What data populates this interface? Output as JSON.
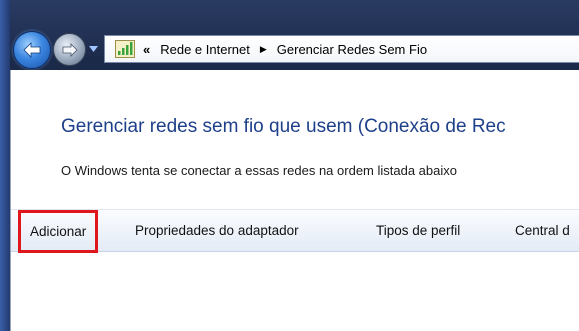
{
  "window": {
    "breadcrumb": {
      "overflow_label": "«",
      "items": [
        "Rede e Internet",
        "Gerenciar Redes Sem Fio"
      ],
      "separator": "▶"
    }
  },
  "icons": {
    "back": "back-arrow-icon",
    "forward": "forward-arrow-icon",
    "history": "chevron-down-icon",
    "network": "network-signal-icon"
  },
  "main": {
    "title": "Gerenciar redes sem fio que usem (Conexão de Rec",
    "description": "O Windows tenta se conectar a essas redes na ordem listada abaixo"
  },
  "toolbar": {
    "add_label": "Adicionar",
    "adapter_properties_label": "Propriedades do adaptador",
    "profile_types_label": "Tipos de perfil",
    "center_label": "Central d"
  },
  "colors": {
    "title": "#1e3f8a",
    "highlight": "#e0161d",
    "frame": "#1c2a4a"
  }
}
